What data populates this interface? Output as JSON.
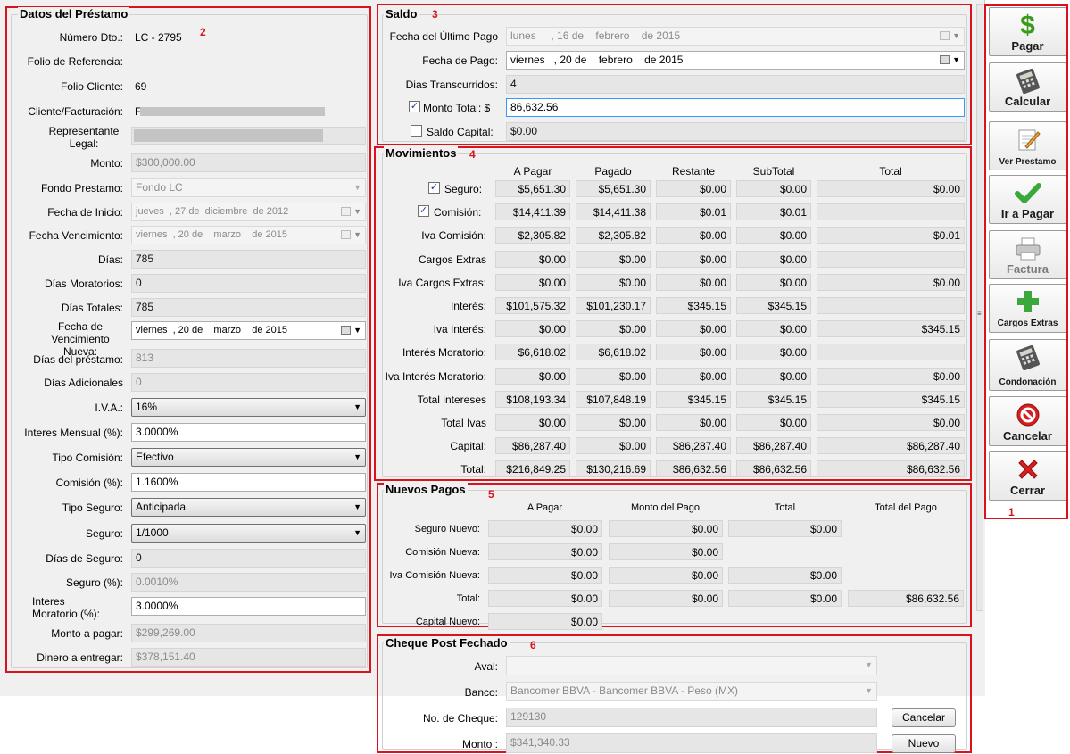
{
  "datos": {
    "title": "Datos del Préstamo",
    "marker": "2",
    "rows": [
      {
        "label": "Número Dto.:",
        "value": "LC - 2795"
      },
      {
        "label": "Folio de Referencia:",
        "value": ""
      },
      {
        "label": "Folio Cliente:",
        "value": "69"
      },
      {
        "label": "Cliente/Facturación:",
        "value": "F"
      },
      {
        "label": "Representante Legal:",
        "value": ""
      },
      {
        "label": "Monto:",
        "value": "$300,000.00"
      },
      {
        "label": "Fondo Prestamo:",
        "value": "Fondo LC"
      },
      {
        "label": "Fecha de Inicio:",
        "value": "jueves  , 27 de  diciembre  de 2012"
      },
      {
        "label": "Fecha Vencimiento:",
        "value": "viernes  , 20 de    marzo    de 2015"
      },
      {
        "label": "Días:",
        "value": "785"
      },
      {
        "label": "Días Moratorios:",
        "value": "0"
      },
      {
        "label": "Días Totales:",
        "value": "785"
      },
      {
        "label": "Fecha de Vencimiento Nueva:",
        "value": "viernes  , 20 de    marzo    de 2015"
      },
      {
        "label": "Días del préstamo:",
        "value": "813"
      },
      {
        "label": "Días Adicionales",
        "value": "0"
      },
      {
        "label": "I.V.A.:",
        "value": "16%"
      },
      {
        "label": "Interes Mensual (%):",
        "value": "3.0000%"
      },
      {
        "label": "Tipo Comisión:",
        "value": "Efectivo"
      },
      {
        "label": "Comisión (%):",
        "value": "1.1600%"
      },
      {
        "label": "Tipo Seguro:",
        "value": "Anticipada"
      },
      {
        "label": "Seguro:",
        "value": "1/1000"
      },
      {
        "label": "Días de Seguro:",
        "value": "0"
      },
      {
        "label": "Seguro (%):",
        "value": "0.0010%"
      },
      {
        "label": "Interes Moratorio (%):",
        "value": "3.0000%"
      },
      {
        "label": "Monto a pagar:",
        "value": "$299,269.00"
      },
      {
        "label": "Dinero a entregar:",
        "value": "$378,151.40"
      }
    ]
  },
  "saldo": {
    "title": "Saldo",
    "marker": "3",
    "rows": [
      {
        "label": "Fecha del Último Pago",
        "value": "lunes     , 16 de    febrero    de 2015"
      },
      {
        "label": "Fecha de Pago:",
        "value": "viernes   , 20 de    febrero    de 2015"
      },
      {
        "label": "Dias Transcurridos:",
        "value": "4"
      },
      {
        "label": "Monto Total: $",
        "value": "86,632.56"
      },
      {
        "label": "Saldo Capital:",
        "value": "$0.00"
      }
    ]
  },
  "movimientos": {
    "title": "Movimientos",
    "marker": "4",
    "columns": [
      "A Pagar",
      "Pagado",
      "Restante",
      "SubTotal",
      "Total"
    ],
    "rows": [
      {
        "label": "Seguro:",
        "check": true,
        "cells": [
          "$5,651.30",
          "$5,651.30",
          "$0.00",
          "$0.00",
          "$0.00"
        ]
      },
      {
        "label": "Comisión:",
        "check": true,
        "cells": [
          "$14,411.39",
          "$14,411.38",
          "$0.01",
          "$0.01",
          ""
        ]
      },
      {
        "label": "Iva Comisión:",
        "cells": [
          "$2,305.82",
          "$2,305.82",
          "$0.00",
          "$0.00",
          "$0.01"
        ]
      },
      {
        "label": "Cargos Extras",
        "cells": [
          "$0.00",
          "$0.00",
          "$0.00",
          "$0.00",
          ""
        ]
      },
      {
        "label": "Iva Cargos Extras:",
        "cells": [
          "$0.00",
          "$0.00",
          "$0.00",
          "$0.00",
          "$0.00"
        ]
      },
      {
        "label": "Interés:",
        "cells": [
          "$101,575.32",
          "$101,230.17",
          "$345.15",
          "$345.15",
          ""
        ]
      },
      {
        "label": "Iva Interés:",
        "cells": [
          "$0.00",
          "$0.00",
          "$0.00",
          "$0.00",
          "$345.15"
        ]
      },
      {
        "label": "Interés Moratorio:",
        "cells": [
          "$6,618.02",
          "$6,618.02",
          "$0.00",
          "$0.00",
          ""
        ]
      },
      {
        "label": "Iva Interés Moratorio:",
        "cells": [
          "$0.00",
          "$0.00",
          "$0.00",
          "$0.00",
          "$0.00"
        ]
      },
      {
        "label": "Total intereses",
        "cells": [
          "$108,193.34",
          "$107,848.19",
          "$345.15",
          "$345.15",
          "$345.15"
        ]
      },
      {
        "label": "Total Ivas",
        "cells": [
          "$0.00",
          "$0.00",
          "$0.00",
          "$0.00",
          "$0.00"
        ]
      },
      {
        "label": "Capital:",
        "cells": [
          "$86,287.40",
          "$0.00",
          "$86,287.40",
          "$86,287.40",
          "$86,287.40"
        ]
      },
      {
        "label": "Total:",
        "cells": [
          "$216,849.25",
          "$130,216.69",
          "$86,632.56",
          "$86,632.56",
          "$86,632.56"
        ]
      }
    ]
  },
  "nuevos": {
    "title": "Nuevos Pagos",
    "marker": "5",
    "columns": [
      "A Pagar",
      "Monto del Pago",
      "Total",
      "Total del Pago"
    ],
    "rows": [
      {
        "label": "Seguro Nuevo:",
        "cells": [
          "$0.00",
          "$0.00",
          "$0.00",
          ""
        ]
      },
      {
        "label": "Comisión Nueva:",
        "cells": [
          "$0.00",
          "$0.00",
          "",
          ""
        ]
      },
      {
        "label": "Iva Comisión Nueva:",
        "cells": [
          "$0.00",
          "$0.00",
          "$0.00",
          ""
        ]
      },
      {
        "label": "Total:",
        "cells": [
          "$0.00",
          "$0.00",
          "$0.00",
          "$86,632.56"
        ]
      },
      {
        "label": "Capital Nuevo:",
        "cells": [
          "$0.00",
          "",
          "",
          ""
        ]
      }
    ]
  },
  "cheque": {
    "title": "Cheque Post Fechado",
    "marker": "6",
    "aval_label": "Aval:",
    "aval_value": "",
    "banco_label": "Banco:",
    "banco_value": "Bancomer BBVA - Bancomer BBVA - Peso (MX)",
    "cheque_label": "No. de Cheque:",
    "cheque_value": "129130",
    "monto_label": "Monto :",
    "monto_value": "$341,340.33",
    "cancel_label": "Cancelar",
    "nuevo_label": "Nuevo"
  },
  "sidebar": {
    "marker": "1",
    "buttons": [
      {
        "label": "Pagar",
        "icon": "dollar-icon"
      },
      {
        "label": "Calcular",
        "icon": "calculator-icon"
      },
      {
        "label": "Ver Prestamo",
        "icon": "edit-document-icon"
      },
      {
        "label": "Ir a Pagar",
        "icon": "checkmark-icon"
      },
      {
        "label": "Factura",
        "icon": "printer-icon"
      },
      {
        "label": "Cargos Extras",
        "icon": "plus-icon"
      },
      {
        "label": "Condonación",
        "icon": "calculator-icon"
      },
      {
        "label": "Cancelar",
        "icon": "cancel-icon"
      },
      {
        "label": "Cerrar",
        "icon": "close-icon"
      }
    ]
  },
  "colors": {
    "annotation_red": "#d9121e",
    "readonly_bg": "#e6e6e6",
    "check_green": "#3aa83a",
    "dollar_green": "#3a9a1a"
  }
}
